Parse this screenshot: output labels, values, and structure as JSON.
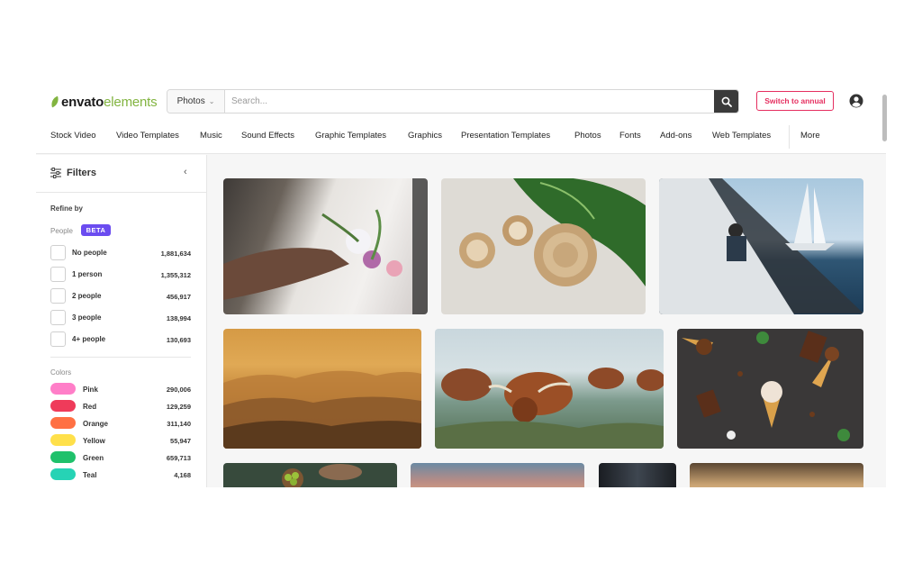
{
  "brand": {
    "bold": "envato",
    "light": "elements",
    "accent": "#82b440"
  },
  "search": {
    "category": "Photos",
    "placeholder": "Search..."
  },
  "header": {
    "annual_label": "Switch to annual"
  },
  "nav": {
    "items": [
      "Stock Video",
      "Video Templates",
      "Music",
      "Sound Effects",
      "Graphic Templates",
      "Graphics",
      "Presentation Templates",
      "Photos",
      "Fonts",
      "Add-ons",
      "Web Templates"
    ],
    "more": "More"
  },
  "filters": {
    "title": "Filters",
    "refine": "Refine by",
    "people_label": "People",
    "beta": "BETA",
    "people": [
      {
        "label": "No people",
        "count": "1,881,634"
      },
      {
        "label": "1 person",
        "count": "1,355,312"
      },
      {
        "label": "2 people",
        "count": "456,917"
      },
      {
        "label": "3 people",
        "count": "138,994"
      },
      {
        "label": "4+ people",
        "count": "130,693"
      }
    ],
    "colors_label": "Colors",
    "colors": [
      {
        "name": "Pink",
        "count": "290,006",
        "hex": "#ff7ec8"
      },
      {
        "name": "Red",
        "count": "129,259",
        "hex": "#ef3b5a"
      },
      {
        "name": "Orange",
        "count": "311,140",
        "hex": "#ff7043"
      },
      {
        "name": "Yellow",
        "count": "55,947",
        "hex": "#ffe04a"
      },
      {
        "name": "Green",
        "count": "659,713",
        "hex": "#1fc16b"
      },
      {
        "name": "Teal",
        "count": "4,168",
        "hex": "#26d3b5"
      }
    ]
  },
  "photos": [
    {
      "name": "photo-flowers-hands"
    },
    {
      "name": "photo-wooden-bowls"
    },
    {
      "name": "photo-sailboat"
    },
    {
      "name": "photo-misty-landscape"
    },
    {
      "name": "photo-highland-cattle"
    },
    {
      "name": "photo-ice-cream-chocolate"
    },
    {
      "name": "photo-grapes-bowl"
    },
    {
      "name": "photo-sunset-sky"
    },
    {
      "name": "photo-dark-partial"
    },
    {
      "name": "photo-golden-sky"
    }
  ]
}
